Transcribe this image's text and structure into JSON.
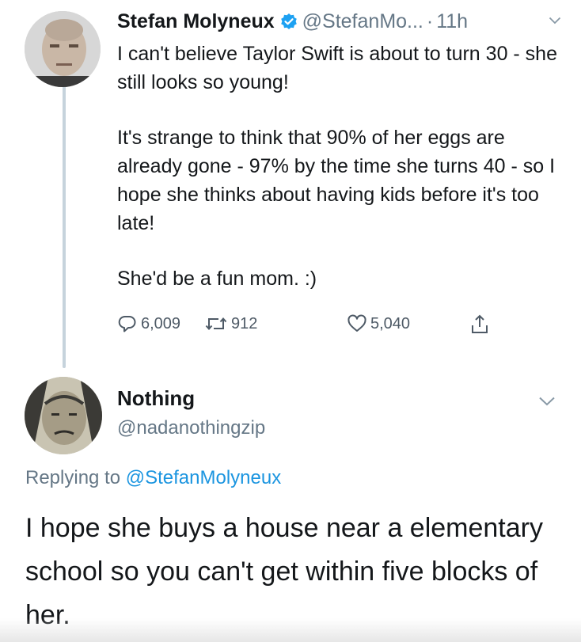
{
  "tweet1": {
    "author_name": "Stefan Molyneux",
    "handle": "@StefanMo...",
    "separator": "·",
    "time": "11h",
    "paragraphs": [
      "I can't believe Taylor Swift is about to turn 30 - she still looks so young!",
      "It's strange to think that 90% of her eggs are already gone - 97% by the time she turns 40 - so I hope she thinks about having kids before it's too late!",
      "She'd be a fun mom. :)"
    ],
    "stats": {
      "replies": "6,009",
      "retweets": "912",
      "likes": "5,040"
    }
  },
  "tweet2": {
    "author_name": "Nothing",
    "handle": "@nadanothingzip",
    "replying_prefix": "Replying to",
    "replying_to": "@StefanMolyneux",
    "text": "I hope she buys a house near a elementary school so you can't get within five blocks of her."
  },
  "icons": {
    "verified": "verified-badge-icon",
    "caret": "chevron-down-icon",
    "reply": "reply-icon",
    "retweet": "retweet-icon",
    "like": "heart-icon",
    "share": "share-icon"
  },
  "colors": {
    "verified_blue": "#1da1f2",
    "mention_blue": "#1b95e0",
    "secondary_text": "#657786",
    "thread_line": "#c6d3dc"
  }
}
